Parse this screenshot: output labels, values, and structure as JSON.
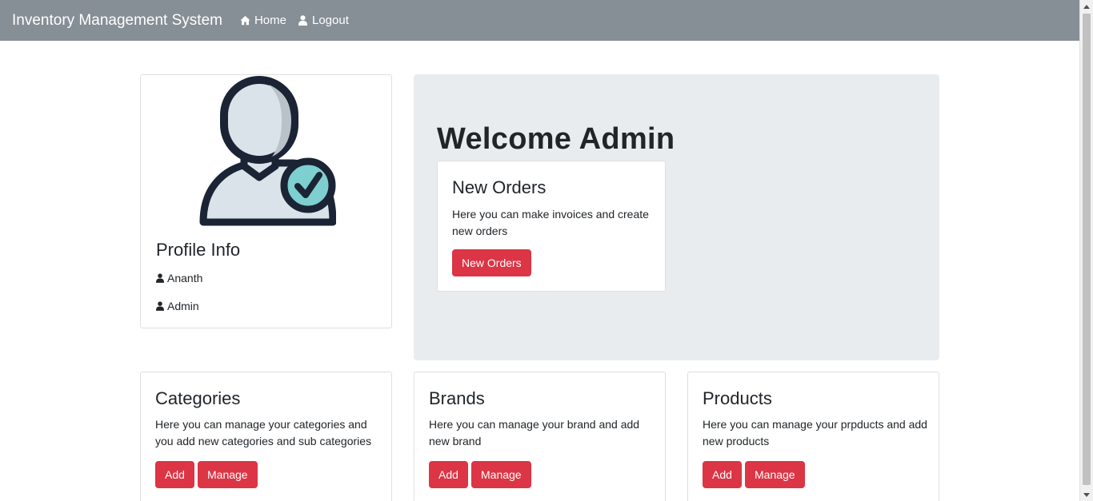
{
  "navbar": {
    "brand": "Inventory Management System",
    "home": "Home",
    "logout": "Logout",
    "home_icon": "home-icon",
    "logout_icon": "user-icon"
  },
  "profile": {
    "title": "Profile Info",
    "name": "Ananth",
    "role": "Admin"
  },
  "welcome": {
    "heading": "Welcome Admin",
    "orders": {
      "title": "New Orders",
      "text": "Here you can make invoices and create new orders",
      "button": "New Orders"
    }
  },
  "cards": {
    "categories": {
      "title": "Categories",
      "text": "Here you can manage your categories and you add new categories and sub categories",
      "add": "Add",
      "manage": "Manage"
    },
    "brands": {
      "title": "Brands",
      "text": "Here you can manage your brand and add new brand",
      "add": "Add",
      "manage": "Manage"
    },
    "products": {
      "title": "Products",
      "text": "Here you can manage your prpducts and add new products",
      "add": "Add",
      "manage": "Manage"
    }
  },
  "colors": {
    "navbar": "#868e96",
    "danger": "#dc3545",
    "jumbotron": "#e9ecef",
    "check": "#7ecfcf",
    "outline": "#1a2434"
  }
}
